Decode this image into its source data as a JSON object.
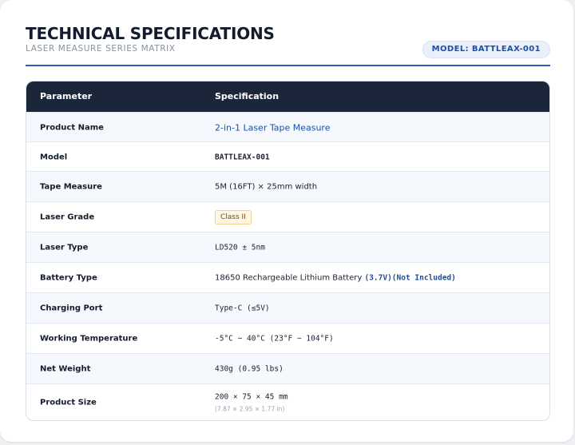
{
  "header": {
    "title": "TECHNICAL SPECIFICATIONS",
    "subtitle": "LASER MEASURE SERIES MATRIX",
    "model_badge": "MODEL: BATTLEAX-001"
  },
  "table": {
    "columns": [
      "Parameter",
      "Specification"
    ],
    "rows": [
      {
        "param": "Product Name",
        "spec": "2-in-1 Laser Tape Measure"
      },
      {
        "param": "Model",
        "spec": "BATTLEAX-001"
      },
      {
        "param": "Tape Measure",
        "spec": "5M (16FT) × 25mm width"
      },
      {
        "param": "Laser Grade",
        "spec": "Class II"
      },
      {
        "param": "Laser Type",
        "spec": "LD520 ± 5nm"
      },
      {
        "param": "Battery Type",
        "spec": "18650 Rechargeable Lithium Battery",
        "spec_extra": "(3.7V)(Not Included)"
      },
      {
        "param": "Charging Port",
        "spec": "Type-C (≤5V)"
      },
      {
        "param": "Working Temperature",
        "spec": "-5°C ~ 40°C (23°F ~ 104°F)"
      },
      {
        "param": "Net Weight",
        "spec": "430g (0.95 lbs)"
      },
      {
        "param": "Product Size",
        "spec": "200 × 75 × 45 mm",
        "spec_note": "(7.87 × 2.95 × 1.77 in)"
      }
    ]
  },
  "colors": {
    "header_bg": "#1b263b",
    "accent": "#1f4fa5",
    "rule": "#2a5fc1",
    "badge_bg": "#fff7e3"
  }
}
